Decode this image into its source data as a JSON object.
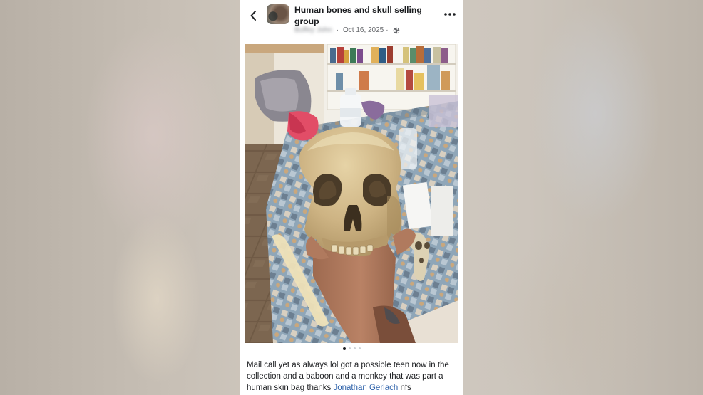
{
  "post": {
    "group_title": "Human  bones and skull  selling group",
    "author_name": "Buffey John",
    "date": "Oct 16, 2025",
    "visibility_icon": "globe-icon",
    "caption_text": "Mail call yet as always lol got a possible teen now in the collection and a baboon and a monkey that was part a human skin bag thanks ",
    "caption_link": "Jonathan Gerlach",
    "caption_suffix": " nfs",
    "carousel": {
      "current_page": 1,
      "total_pages": 4
    }
  },
  "icons": {
    "back": "back-arrow-icon",
    "more": "more-options-icon"
  },
  "colors": {
    "link": "#2a5fa8",
    "text": "#1c1e21",
    "meta": "#65676b",
    "page_background": "#c9c2b8"
  }
}
